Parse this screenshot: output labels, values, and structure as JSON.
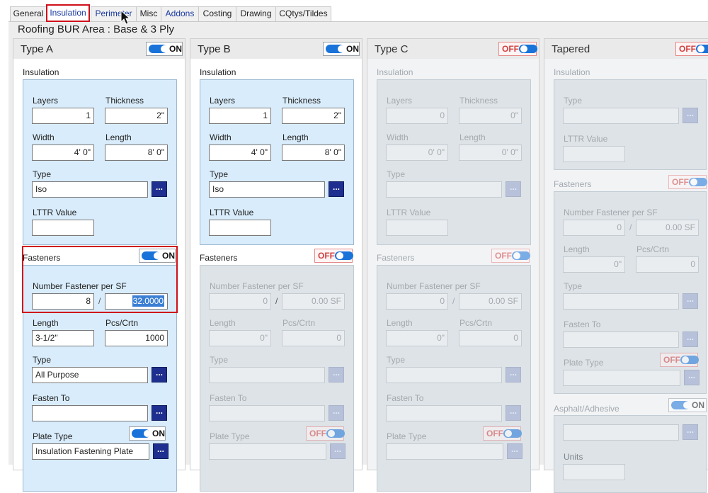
{
  "tabs": [
    {
      "label": "General"
    },
    {
      "label": "Insulation"
    },
    {
      "label": "Perimeter"
    },
    {
      "label": "Misc"
    },
    {
      "label": "Addons"
    },
    {
      "label": "Costing"
    },
    {
      "label": "Drawing"
    },
    {
      "label": "CQtys/Tildes"
    }
  ],
  "area_title": "Roofing BUR Area : Base & 3 Ply",
  "labels": {
    "insulation": "Insulation",
    "layers": "Layers",
    "thickness": "Thickness",
    "width": "Width",
    "length": "Length",
    "type": "Type",
    "ltr_value": "LTTR Value",
    "fasteners": "Fasteners",
    "num_fastener": "Number Fastener per SF",
    "pcs_crtn": "Pcs/Crtn",
    "fasten_to": "Fasten To",
    "plate_type": "Plate Type",
    "asphalt": "Asphalt/Adhesive",
    "units": "Units",
    "browse": "...",
    "slash": "/",
    "on": "ON",
    "off": "OFF"
  },
  "colA": {
    "title": "Type A",
    "toggle": "ON",
    "layers": "1",
    "thickness": "2\"",
    "width": "4' 0\"",
    "length": "8' 0\"",
    "type": "Iso",
    "ltr": "",
    "fasteners_toggle": "ON",
    "num_fastener": "8",
    "num_per_sf": "32.0000",
    "fastener_length": "3-1/2\"",
    "pcs_crtn": "1000",
    "fastener_type": "All Purpose",
    "fasten_to": "",
    "plate_toggle": "ON",
    "plate_type": "Insulation Fastening Plate"
  },
  "colB": {
    "title": "Type B",
    "toggle": "ON",
    "layers": "1",
    "thickness": "2\"",
    "width": "4' 0\"",
    "length": "8' 0\"",
    "type": "Iso",
    "ltr": "",
    "fasteners_toggle": "OFF",
    "num_fastener": "0",
    "num_per_sf": "0.00 SF",
    "fastener_length": "0\"",
    "pcs_crtn": "0",
    "plate_toggle": "OFF"
  },
  "colC": {
    "title": "Type C",
    "toggle": "OFF",
    "layers": "0",
    "thickness": "0\"",
    "width": "0' 0\"",
    "length": "0' 0\"",
    "fasteners_toggle": "OFF",
    "num_fastener": "0",
    "num_per_sf": "0.00 SF",
    "fastener_length": "0\"",
    "pcs_crtn": "0",
    "plate_toggle": "OFF"
  },
  "colT": {
    "title": "Tapered",
    "toggle": "OFF",
    "fasteners_toggle": "OFF",
    "num_fastener": "0",
    "num_per_sf": "0.00 SF",
    "fastener_length": "0\"",
    "pcs_crtn": "0",
    "plate_toggle": "OFF",
    "asphalt_toggle": "ON"
  }
}
